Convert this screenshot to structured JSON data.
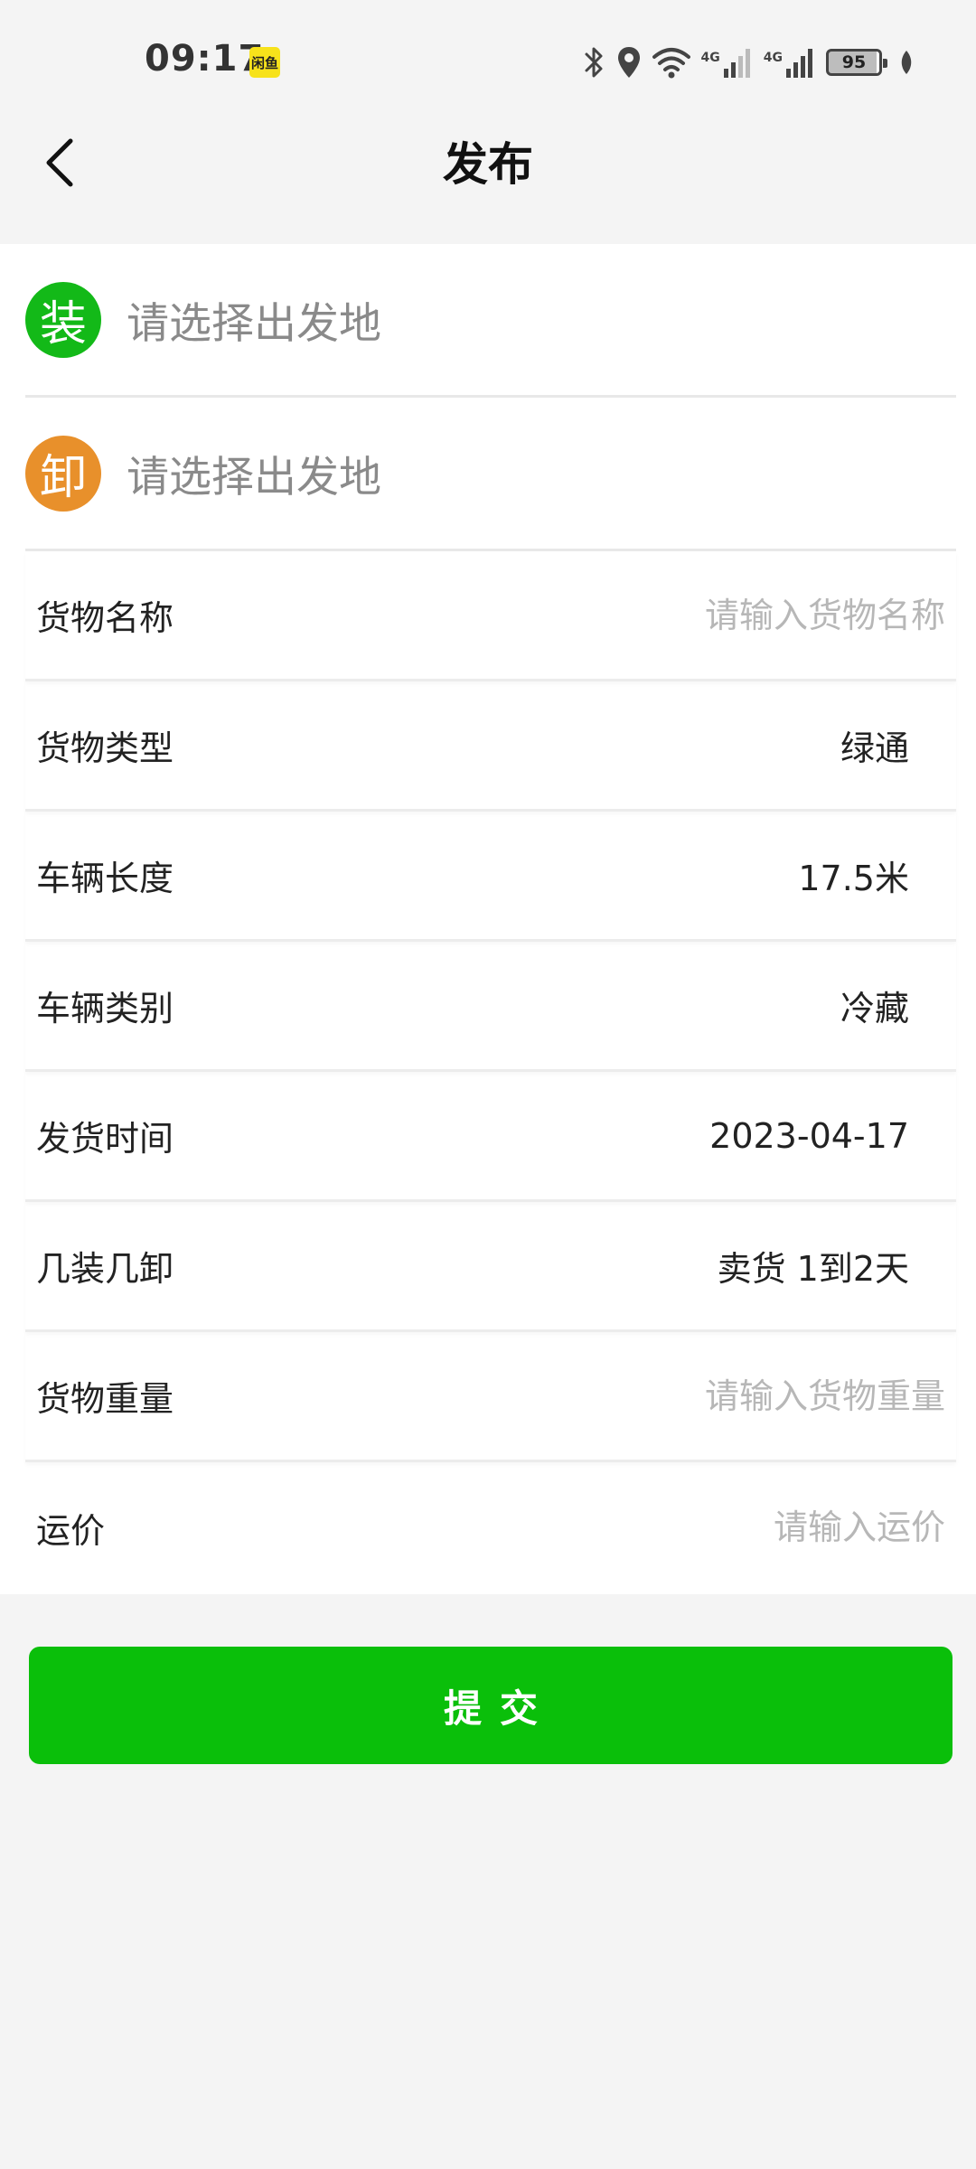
{
  "status_bar": {
    "time": "09:17",
    "app_badge": "闲鱼",
    "net1": "4G",
    "net2": "4G",
    "battery": "95"
  },
  "header": {
    "title": "发布",
    "back_icon": "chevron-left-icon"
  },
  "locations": {
    "load": {
      "badge": "装",
      "placeholder": "请选择出发地",
      "color": "#13b918"
    },
    "unload": {
      "badge": "卸",
      "placeholder": "请选择出发地",
      "color": "#e8902b"
    }
  },
  "fields": {
    "cargo_name": {
      "label": "货物名称",
      "value": "",
      "placeholder": "请输入货物名称"
    },
    "cargo_type": {
      "label": "货物类型",
      "value": "绿通"
    },
    "vehicle_length": {
      "label": "车辆长度",
      "value": "17.5米"
    },
    "vehicle_category": {
      "label": "车辆类别",
      "value": "冷藏"
    },
    "ship_time": {
      "label": "发货时间",
      "value": "2023-04-17"
    },
    "load_unload": {
      "label": "几装几卸",
      "value": "卖货 1到2天"
    },
    "cargo_weight": {
      "label": "货物重量",
      "value": "",
      "placeholder": "请输入货物重量"
    },
    "freight": {
      "label": "运价",
      "value": "",
      "placeholder": "请输入运价"
    }
  },
  "submit": {
    "label": "提交",
    "color": "#0abf0a"
  }
}
